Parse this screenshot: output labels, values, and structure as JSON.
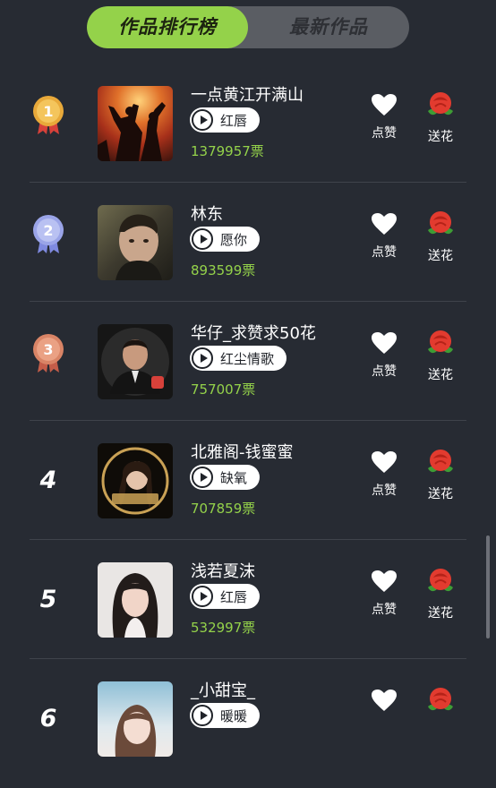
{
  "tabs": {
    "active": "作品排行榜",
    "inactive": "最新作品"
  },
  "actions": {
    "like": "点赞",
    "flower": "送花"
  },
  "entries": [
    {
      "rank": "1",
      "title": "一点黄江开满山",
      "song": "红唇",
      "votes": "1379957票"
    },
    {
      "rank": "2",
      "title": "林东",
      "song": "愿你",
      "votes": "893599票"
    },
    {
      "rank": "3",
      "title": "华仔_求赞求50花",
      "song": "红尘情歌",
      "votes": "757007票"
    },
    {
      "rank": "4",
      "title": "北雅阁-钱蜜蜜",
      "song": "缺氧",
      "votes": "707859票"
    },
    {
      "rank": "5",
      "title": "浅若夏沫",
      "song": "红唇",
      "votes": "532997票"
    },
    {
      "rank": "6",
      "title": "_小甜宝_",
      "song": "暖暖",
      "votes": ""
    }
  ],
  "colors": {
    "background": "#272b33",
    "accent": "#94d24a",
    "gold": "#e8a93a",
    "silver": "#9aa4e8",
    "bronze": "#d98466",
    "rose": "#e23b2f"
  },
  "icons": {
    "play": "play-icon",
    "heart": "heart-icon",
    "rose": "rose-icon",
    "medal": "medal-icon"
  }
}
